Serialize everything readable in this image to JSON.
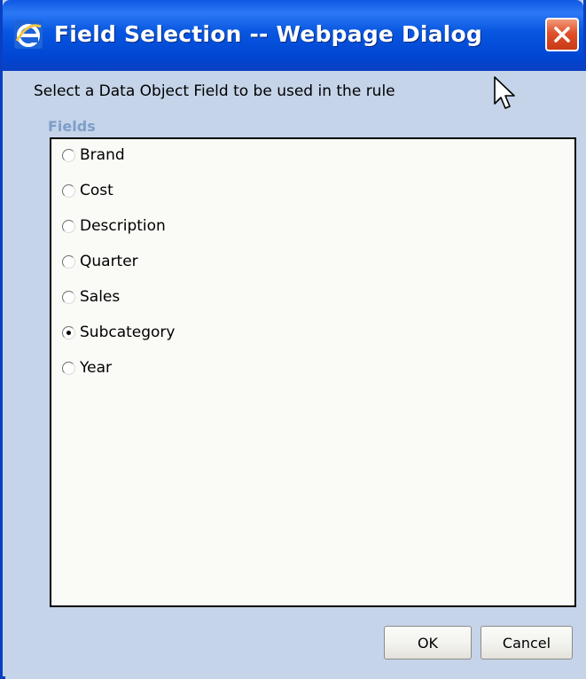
{
  "window": {
    "title": "Field Selection -- Webpage Dialog",
    "icon": "internet-explorer-icon",
    "close_icon": "close-icon",
    "accent_color": "#0054e3",
    "close_color": "#e0512a"
  },
  "dialog": {
    "prompt": "Select a Data Object Field to be used in the rule",
    "fields_label": "Fields",
    "selected_field": "Subcategory",
    "fields": [
      {
        "label": "Brand",
        "checked": false
      },
      {
        "label": "Cost",
        "checked": false
      },
      {
        "label": "Description",
        "checked": false
      },
      {
        "label": "Quarter",
        "checked": false
      },
      {
        "label": "Sales",
        "checked": false
      },
      {
        "label": "Subcategory",
        "checked": true
      },
      {
        "label": "Year",
        "checked": false
      }
    ]
  },
  "buttons": {
    "ok_label": "OK",
    "cancel_label": "Cancel"
  }
}
